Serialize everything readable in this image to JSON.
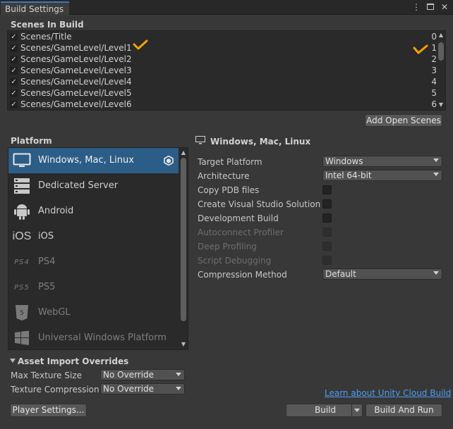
{
  "window": {
    "tab_title": "Build Settings",
    "icons": [
      "more-icon",
      "maximize-icon",
      "close-icon"
    ]
  },
  "scenes": {
    "title": "Scenes In Build",
    "items": [
      {
        "name": "Scenes/Title",
        "index": "0",
        "checked": true
      },
      {
        "name": "Scenes/GameLevel/Level1",
        "index": "1",
        "checked": true
      },
      {
        "name": "Scenes/GameLevel/Level2",
        "index": "2",
        "checked": true
      },
      {
        "name": "Scenes/GameLevel/Level3",
        "index": "3",
        "checked": true
      },
      {
        "name": "Scenes/GameLevel/Level4",
        "index": "4",
        "checked": true
      },
      {
        "name": "Scenes/GameLevel/Level5",
        "index": "5",
        "checked": true
      },
      {
        "name": "Scenes/GameLevel/Level6",
        "index": "6",
        "checked": true
      }
    ],
    "add_open_scenes_label": "Add Open Scenes"
  },
  "platform": {
    "title": "Platform",
    "items": [
      {
        "label": "Windows, Mac, Linux",
        "icon": "monitor-icon",
        "selected": true,
        "enabled": true
      },
      {
        "label": "Dedicated Server",
        "icon": "server-icon",
        "selected": false,
        "enabled": true
      },
      {
        "label": "Android",
        "icon": "android-icon",
        "selected": false,
        "enabled": true
      },
      {
        "label": "iOS",
        "icon": "ios-icon",
        "selected": false,
        "enabled": true
      },
      {
        "label": "PS4",
        "icon": "ps4-icon",
        "selected": false,
        "enabled": false
      },
      {
        "label": "PS5",
        "icon": "ps5-icon",
        "selected": false,
        "enabled": false
      },
      {
        "label": "WebGL",
        "icon": "html5-icon",
        "selected": false,
        "enabled": false
      },
      {
        "label": "Universal Windows Platform",
        "icon": "windows-icon",
        "selected": false,
        "enabled": false
      }
    ]
  },
  "settings": {
    "header": "Windows, Mac, Linux",
    "target_platform_label": "Target Platform",
    "target_platform_value": "Windows",
    "architecture_label": "Architecture",
    "architecture_value": "Intel 64-bit",
    "copy_pdb_label": "Copy PDB files",
    "create_vs_label": "Create Visual Studio Solution",
    "development_build_label": "Development Build",
    "autoconnect_label": "Autoconnect Profiler",
    "deep_profiling_label": "Deep Profiling",
    "script_debugging_label": "Script Debugging",
    "compression_label": "Compression Method",
    "compression_value": "Default"
  },
  "asset_overrides": {
    "title": "Asset Import Overrides",
    "max_texture_label": "Max Texture Size",
    "max_texture_value": "No Override",
    "texture_compression_label": "Texture Compression",
    "texture_compression_value": "No Override"
  },
  "footer": {
    "cloud_build_link": "Learn about Unity Cloud Build",
    "player_settings_label": "Player Settings...",
    "build_label": "Build",
    "build_and_run_label": "Build And Run"
  },
  "colors": {
    "accent": "#2c5d87",
    "annotation": "#f4a300",
    "link": "#4c9df5"
  }
}
